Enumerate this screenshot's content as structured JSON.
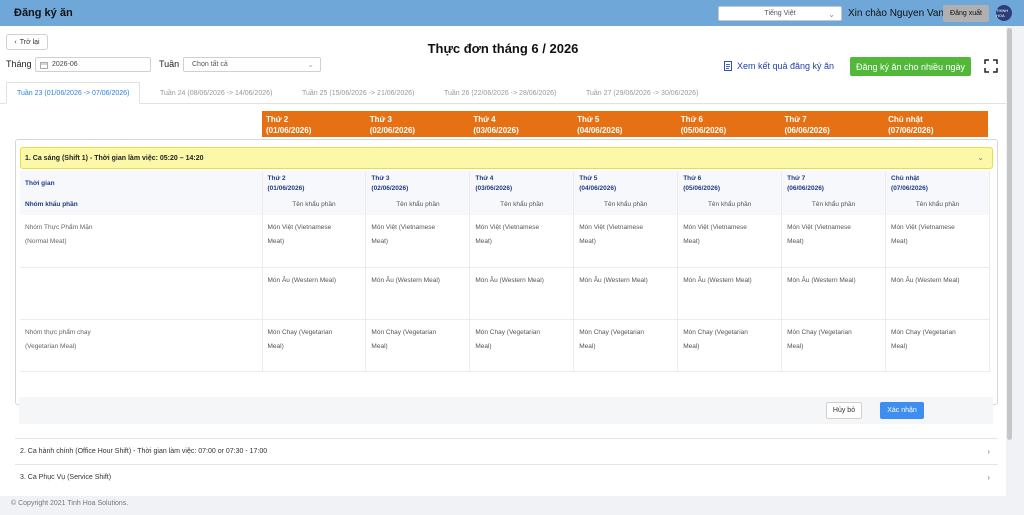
{
  "app": {
    "title": "Đăng ký ăn",
    "language": "Tiếng Việt",
    "greeting": "Xin chào Nguyen Van A",
    "logout": "Đăng xuất",
    "logo_text": "THINH HOA"
  },
  "page": {
    "back": "Trở lại",
    "title": "Thực đơn tháng 6 / 2026"
  },
  "filters": {
    "month_label": "Tháng",
    "month_value": "2026-06",
    "week_label": "Tuần",
    "week_value": "Chọn tất cả"
  },
  "actions": {
    "view_results": "Xem kết quả đăng ký ăn",
    "register_multi": "Đăng ký ăn cho nhiều ngày"
  },
  "tabs": [
    {
      "label": "Tuần 23 (01/06/2026 -> 07/06/2026)",
      "active": true
    },
    {
      "label": "Tuần 24 (08/06/2026 -> 14/06/2026)",
      "active": false
    },
    {
      "label": "Tuần 25 (15/06/2026 -> 21/06/2026)",
      "active": false
    },
    {
      "label": "Tuần 26 (22/06/2026 -> 28/06/2026)",
      "active": false
    },
    {
      "label": "Tuần 27 (29/06/2026 -> 30/06/2026)",
      "active": false
    }
  ],
  "days": [
    {
      "name": "Thứ 2",
      "date": "(01/06/2026)"
    },
    {
      "name": "Thứ 3",
      "date": "(02/06/2026)"
    },
    {
      "name": "Thứ 4",
      "date": "(03/06/2026)"
    },
    {
      "name": "Thứ 5",
      "date": "(04/06/2026)"
    },
    {
      "name": "Thứ 6",
      "date": "(05/06/2026)"
    },
    {
      "name": "Thứ 7",
      "date": "(06/06/2026)"
    },
    {
      "name": "Chủ nhật",
      "date": "(07/06/2026)"
    }
  ],
  "shift1": {
    "title": "1. Ca sáng (Shift 1) - Thời gian làm việc: 05:20 – 14:20",
    "time_header": "Thời gian",
    "group_header": "Nhóm khẩu phần",
    "ration_header": "Tên khẩu phần",
    "rows": [
      {
        "group_line1": "Nhóm Thực Phẩm Mặn",
        "group_line2": "(Normal Meat)",
        "meal_line1": "Món Việt (Vietnamese",
        "meal_line2": "Meat)"
      },
      {
        "group_line1": "",
        "group_line2": "",
        "meal_line1": "Món Âu (Western Meal)",
        "meal_line2": ""
      },
      {
        "group_line1": "Nhóm thực phẩm chay",
        "group_line2": "(Vegetarian Meal)",
        "meal_line1": "Món Chay (Vegetarian",
        "meal_line2": "Meal)"
      }
    ],
    "cancel": "Hủy bỏ",
    "confirm": "Xác nhận"
  },
  "shift2": {
    "title": "2. Ca hành chính (Office Hour Shift) - Thời gian làm việc: 07:00 or 07:30 - 17:00"
  },
  "shift3": {
    "title": "3. Ca Phục Vụ (Service Shift)"
  },
  "footer": {
    "copyright": "© Copyright 2021 Tinh Hoa Solutions."
  },
  "colors": {
    "topbar": "#6fa7d8",
    "day_header": "#e57114",
    "shift_highlight": "#fbf9a8",
    "primary_green": "#52b83a",
    "primary_blue": "#3d8ef0"
  }
}
